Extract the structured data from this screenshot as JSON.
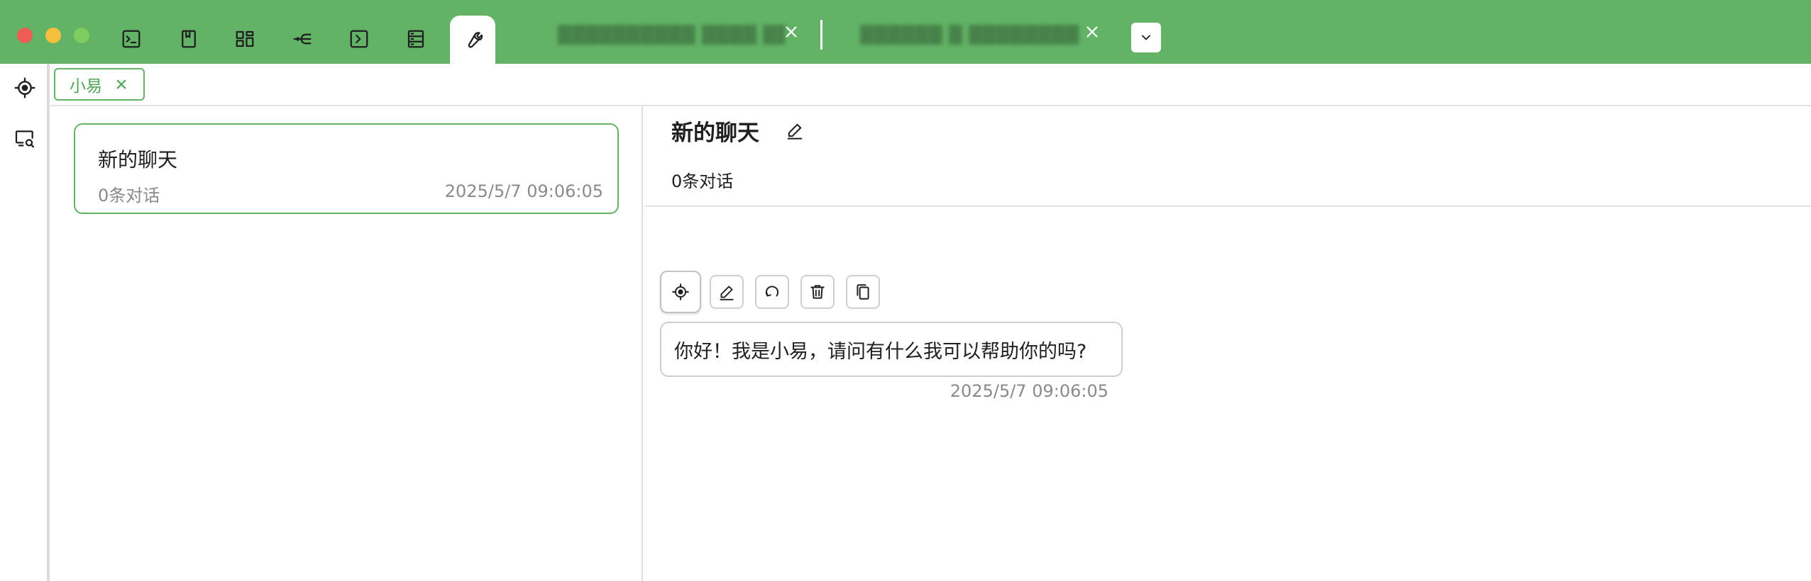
{
  "colors": {
    "accent": "#62b366",
    "accent_text": "#4ea553",
    "muted_text": "#8a8a8a",
    "border": "#cfcfcf"
  },
  "window": {
    "traffic_lights": [
      "close",
      "minimize",
      "zoom"
    ]
  },
  "toolbar": {
    "icons": [
      "terminal-icon",
      "bookmark-icon",
      "layout-icon",
      "git-branch-icon",
      "terminal-box-icon",
      "server-icon",
      "wrench-icon"
    ],
    "active_icon": "wrench-icon"
  },
  "tabs": [
    {
      "title": "██████████ ████ ████ ██ ██",
      "redacted": true
    },
    {
      "title": "██████ █ ████████ ████ █…",
      "redacted": true
    }
  ],
  "rail": {
    "items": [
      "crosshair-icon",
      "screen-search-icon"
    ]
  },
  "page_tab": {
    "label": "小易"
  },
  "conversation_list": [
    {
      "title": "新的聊天",
      "count": "0条对话",
      "time": "2025/5/7 09:06:05"
    }
  ],
  "chat": {
    "title": "新的聊天",
    "subtitle": "0条对话",
    "message": {
      "actions": [
        "avatar-icon",
        "edit-icon",
        "refresh-icon",
        "trash-icon",
        "copy-icon"
      ],
      "text": "你好！我是小易，请问有什么我可以帮助你的吗?",
      "time": "2025/5/7 09:06:05"
    }
  }
}
